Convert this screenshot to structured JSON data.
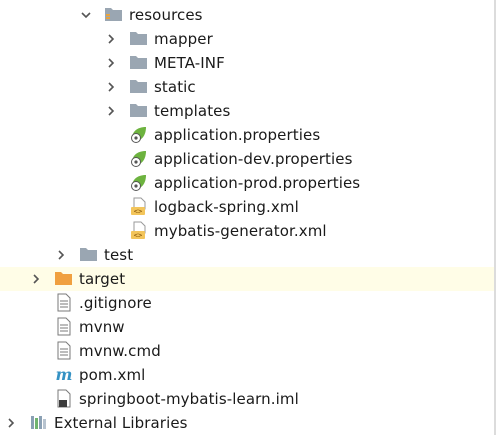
{
  "colors": {
    "highlight_row": "#fffde7",
    "folder_gray": "#9aa6b2",
    "folder_orange": "#f0a040",
    "spring_green": "#6db33f",
    "maven_blue": "#3592c4",
    "xml_orange": "#e8a33d"
  },
  "tree": [
    {
      "label": "resources",
      "icon": "resources-folder-icon",
      "expanded": true
    },
    {
      "label": "mapper",
      "icon": "folder-icon",
      "expanded": false
    },
    {
      "label": "META-INF",
      "icon": "folder-icon",
      "expanded": false
    },
    {
      "label": "static",
      "icon": "folder-icon",
      "expanded": false
    },
    {
      "label": "templates",
      "icon": "folder-icon",
      "expanded": false
    },
    {
      "label": "application.properties",
      "icon": "spring-properties-icon"
    },
    {
      "label": "application-dev.properties",
      "icon": "spring-properties-icon"
    },
    {
      "label": "application-prod.properties",
      "icon": "spring-properties-icon"
    },
    {
      "label": "logback-spring.xml",
      "icon": "xml-file-icon"
    },
    {
      "label": "mybatis-generator.xml",
      "icon": "xml-file-icon"
    },
    {
      "label": "test",
      "icon": "folder-icon",
      "expanded": false
    },
    {
      "label": "target",
      "icon": "excluded-folder-icon",
      "expanded": false,
      "highlighted": true
    },
    {
      "label": ".gitignore",
      "icon": "text-file-icon"
    },
    {
      "label": "mvnw",
      "icon": "text-file-icon"
    },
    {
      "label": "mvnw.cmd",
      "icon": "text-file-icon"
    },
    {
      "label": "pom.xml",
      "icon": "maven-icon"
    },
    {
      "label": "springboot-mybatis-learn.iml",
      "icon": "module-file-icon"
    },
    {
      "label": "External Libraries",
      "icon": "libraries-icon",
      "expanded": false
    }
  ]
}
